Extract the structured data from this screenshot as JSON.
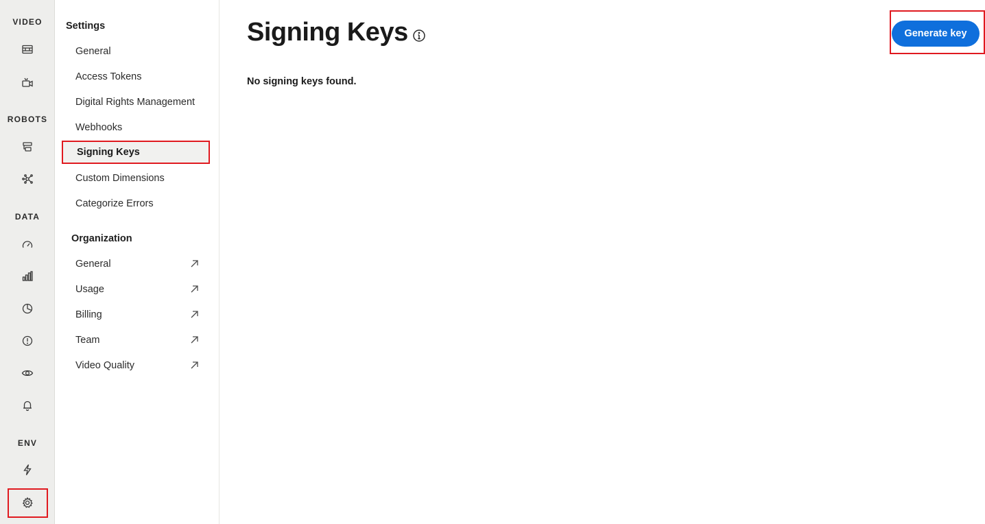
{
  "rail": {
    "sections": [
      {
        "label": "VIDEO"
      },
      {
        "label": "ROBOTS"
      },
      {
        "label": "DATA"
      },
      {
        "label": "ENV"
      }
    ],
    "icons": [
      "film-icon",
      "video-camera-icon",
      "robot-layout-icon",
      "network-nodes-icon",
      "gauge-icon",
      "bar-chart-icon",
      "pie-chart-icon",
      "alert-circle-icon",
      "eye-icon",
      "bell-icon",
      "lightning-icon",
      "gear-icon"
    ],
    "highlight_color": "#e0191f"
  },
  "nav": {
    "settings_heading": "Settings",
    "settings_items": [
      {
        "label": "General"
      },
      {
        "label": "Access Tokens"
      },
      {
        "label": "Digital Rights Management"
      },
      {
        "label": "Webhooks"
      },
      {
        "label": "Signing Keys",
        "active": true
      },
      {
        "label": "Custom Dimensions"
      },
      {
        "label": "Categorize Errors"
      }
    ],
    "organization_heading": "Organization",
    "organization_items": [
      {
        "label": "General",
        "icon": "external-link-icon"
      },
      {
        "label": "Usage",
        "icon": "external-link-icon"
      },
      {
        "label": "Billing",
        "icon": "external-link-icon"
      },
      {
        "label": "Team",
        "icon": "external-link-icon"
      },
      {
        "label": "Video Quality",
        "icon": "external-link-icon"
      }
    ]
  },
  "main": {
    "title": "Signing Keys",
    "info_icon": "info-icon",
    "empty_message": "No signing keys found.",
    "primary_button": "Generate key",
    "accent_color": "#0f6fdc"
  }
}
